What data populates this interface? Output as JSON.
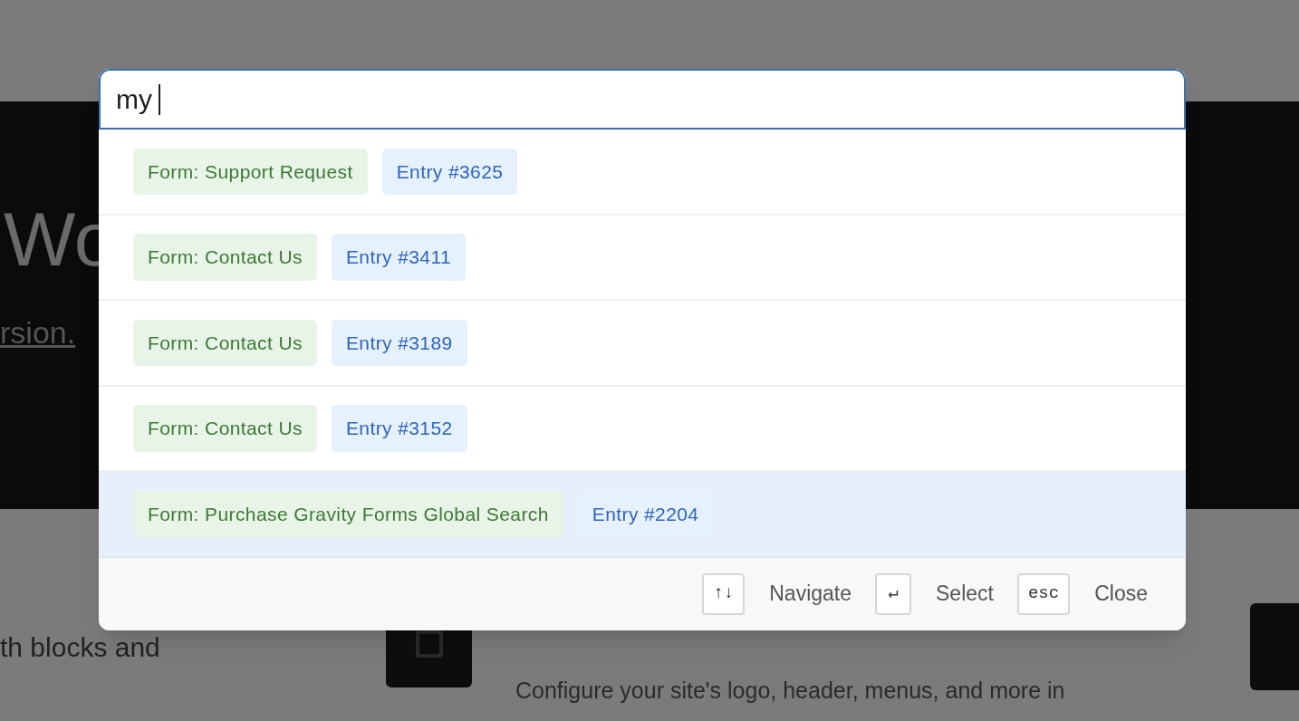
{
  "background": {
    "heading": "Wo",
    "link": "rsion.",
    "text_1": "th blocks and",
    "description": "Configure your site's logo, header, menus, and more in"
  },
  "search": {
    "value": "my"
  },
  "results": [
    {
      "form": "Form: Support Request",
      "entry": "Entry #3625",
      "selected": false
    },
    {
      "form": "Form: Contact Us",
      "entry": "Entry #3411",
      "selected": false
    },
    {
      "form": "Form: Contact Us",
      "entry": "Entry #3189",
      "selected": false
    },
    {
      "form": "Form: Contact Us",
      "entry": "Entry #3152",
      "selected": false
    },
    {
      "form": "Form: Purchase Gravity Forms Global Search",
      "entry": "Entry #2204",
      "selected": true
    }
  ],
  "footer": [
    {
      "key": "↑↓",
      "label": "Navigate"
    },
    {
      "key": "↵",
      "label": "Select"
    },
    {
      "key": "esc",
      "label": "Close"
    }
  ]
}
